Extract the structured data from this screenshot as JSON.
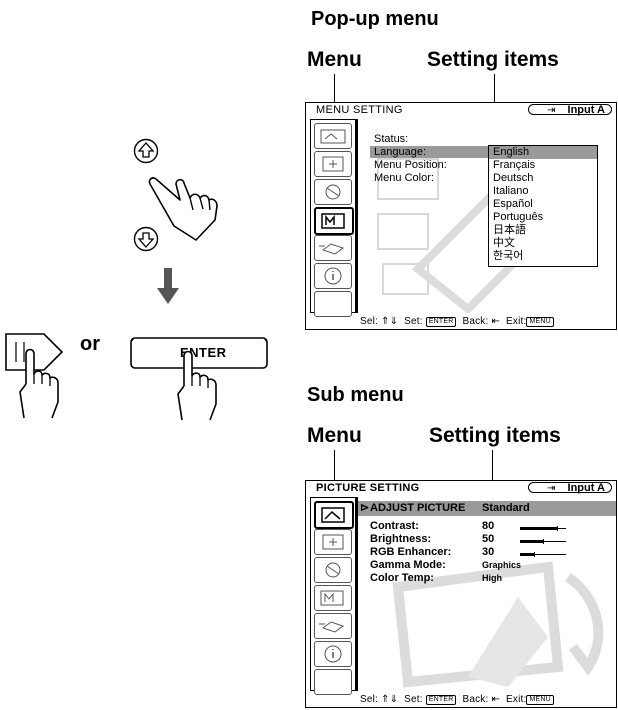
{
  "popup": {
    "heading": "Pop-up menu",
    "label_menu": "Menu",
    "label_setting": "Setting items",
    "screen": {
      "title": "MENU SETTING",
      "input": "Input A",
      "items": [
        "Status:",
        "Language:",
        "Menu Position:",
        "Menu Color:"
      ],
      "languages": [
        "English",
        "Français",
        "Deutsch",
        "Italiano",
        "Español",
        "Português",
        "日本語",
        "中文",
        "한국어"
      ],
      "selected_language": "English"
    }
  },
  "submenu": {
    "heading": "Sub menu",
    "label_menu": "Menu",
    "label_setting": "Setting items",
    "screen": {
      "title": "PICTURE SETTING",
      "input": "Input A",
      "header_item": "ADJUST PICTURE",
      "header_value": "Standard",
      "rows": [
        {
          "label": "Contrast:",
          "value": "80",
          "level": 0.8
        },
        {
          "label": "Brightness:",
          "value": "50",
          "level": 0.5
        },
        {
          "label": "RGB Enhancer:",
          "value": "30",
          "level": 0.3
        },
        {
          "label": "Gamma Mode:",
          "value": "Graphics"
        },
        {
          "label": "Color Temp:",
          "value": "High"
        }
      ]
    }
  },
  "statusbar": {
    "sel": "Sel:",
    "set": "Set:",
    "enter_key": "ENTER",
    "back": "Back:",
    "exit": "Exit:",
    "menu_key": "MENU"
  },
  "controls": {
    "or_text": "or",
    "enter_label": "ENTER"
  },
  "icons": [
    "up-arrow-button-icon",
    "down-arrow-button-icon",
    "pointing-hand-icon",
    "right-arrow-button-icon",
    "enter-button-icon"
  ]
}
